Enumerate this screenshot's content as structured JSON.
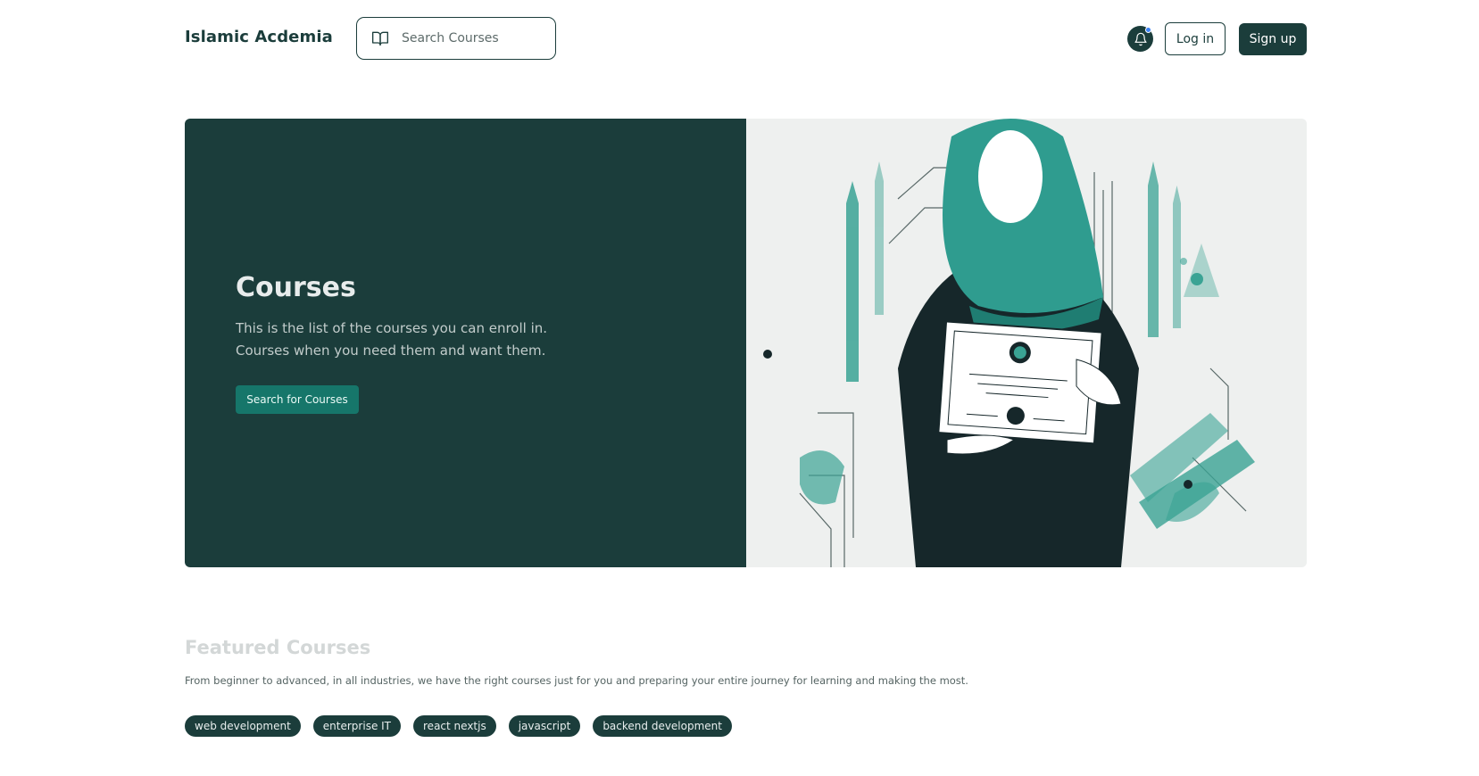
{
  "header": {
    "brand": "Islamic Acdemia",
    "search_placeholder": "Search Courses",
    "login_label": "Log in",
    "signup_label": "Sign up",
    "icons": {
      "search": "book-open-icon",
      "notifications": "bell-icon"
    },
    "notification_dot_color": "#3b82f6"
  },
  "hero": {
    "title": "Courses",
    "description_lines": [
      "This is the list of the courses you can enroll in.",
      "Courses when you need them and want them."
    ],
    "cta_label": "Search for Courses",
    "colors": {
      "panel": "#1b3d3b",
      "cta": "#16766a",
      "accent": "#3aa394"
    }
  },
  "featured": {
    "title": "Featured Courses",
    "description": "From beginner to advanced, in all industries, we have the right courses just for you and preparing your entire journey for learning and making the most.",
    "tags": [
      "web development",
      "enterprise IT",
      "react nextjs",
      "javascript",
      "backend development"
    ]
  }
}
